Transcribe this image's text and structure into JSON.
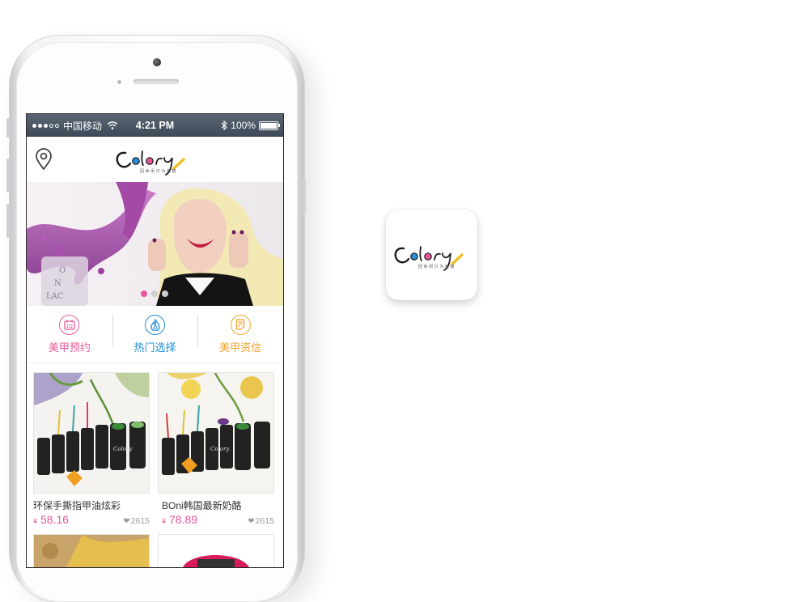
{
  "status_bar": {
    "signal_dots": [
      true,
      true,
      true,
      false,
      false
    ],
    "carrier": "中国移动",
    "time": "4:21 PM",
    "battery": "100%",
    "icons": [
      "wifi-icon",
      "bluetooth-icon",
      "battery-icon"
    ]
  },
  "header": {
    "logo_text": "Colory",
    "logo_tagline": "回 休 闲   只 为 美 丽",
    "location_icon": "map-pin-icon"
  },
  "banner": {
    "bottle_text": [
      "O",
      "N",
      "LAC"
    ],
    "pages": 3,
    "active_page": 0
  },
  "nav": [
    {
      "label": "美甲预约",
      "icon": "calendar-icon",
      "color": "#e8579a"
    },
    {
      "label": "热门选择",
      "icon": "flame-icon",
      "color": "#1e8fd6"
    },
    {
      "label": "美甲资信",
      "icon": "document-icon",
      "color": "#f0a531"
    }
  ],
  "products": [
    {
      "title": "环保手撕指甲油炫彩",
      "currency": "¥",
      "price": "58.16",
      "likes": "2615"
    },
    {
      "title": "BOni韩国最新奶酪",
      "currency": "¥",
      "price": "78.89",
      "likes": "2615"
    }
  ],
  "colors": {
    "accent_pink": "#e8579a",
    "accent_blue": "#1e8fd6",
    "accent_orange": "#f0a531"
  },
  "app_icon": {
    "logo_text": "Colory",
    "logo_tagline": "回 休 闲   只 为 美 丽"
  }
}
